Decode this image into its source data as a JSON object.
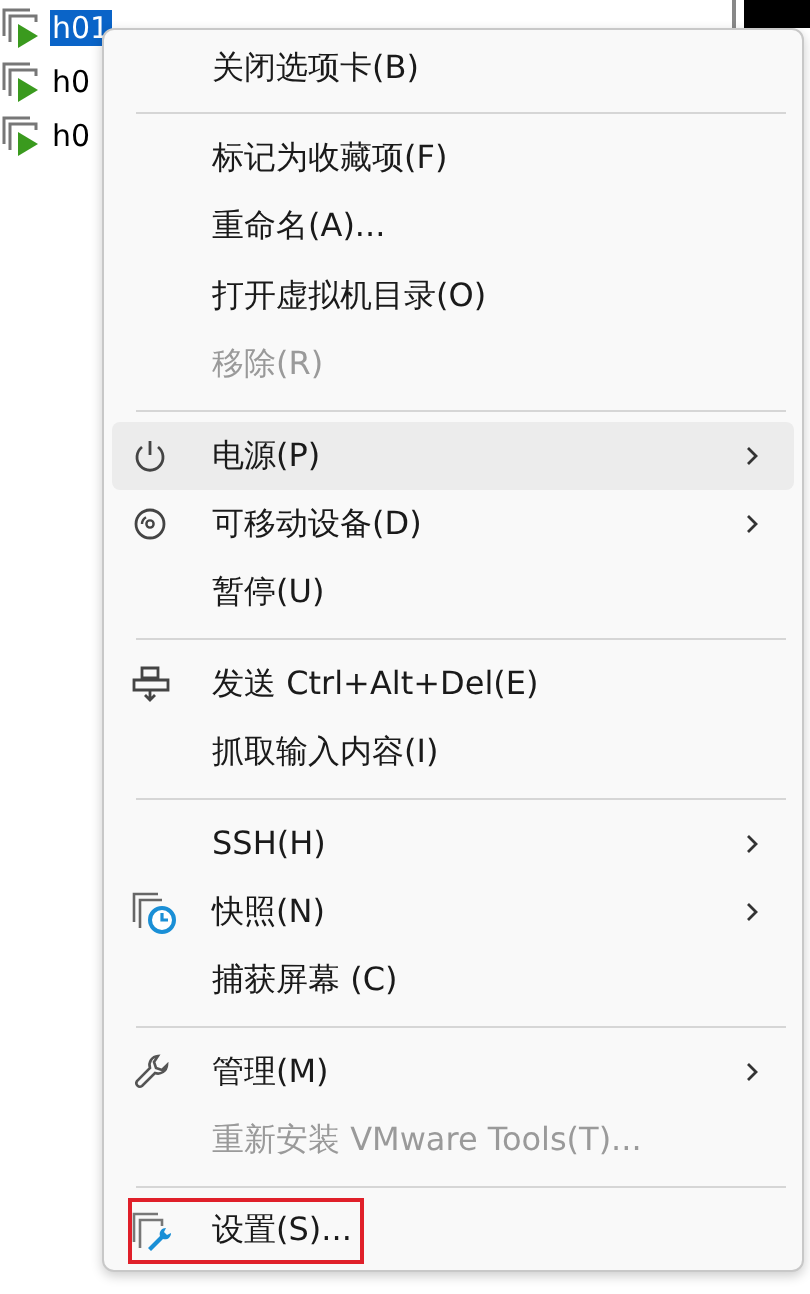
{
  "tree": [
    {
      "label": "h01",
      "selected": true
    },
    {
      "label": "h0",
      "selected": false
    },
    {
      "label": "h0",
      "selected": false
    }
  ],
  "menu": {
    "groups": [
      {
        "items": [
          {
            "label": "关闭选项卡(B)",
            "disabled": false,
            "submenu": false,
            "selected": false,
            "annotated": false
          }
        ]
      },
      {
        "items": [
          {
            "label": "标记为收藏项(F)",
            "disabled": false,
            "submenu": false,
            "selected": false,
            "annotated": false
          },
          {
            "label": "重命名(A)...",
            "disabled": false,
            "submenu": false,
            "selected": false,
            "annotated": false
          },
          {
            "label": "打开虚拟机目录(O)",
            "disabled": false,
            "submenu": false,
            "selected": false,
            "annotated": false
          },
          {
            "label": "移除(R)",
            "disabled": true,
            "submenu": false,
            "selected": false,
            "annotated": false
          }
        ]
      },
      {
        "items": [
          {
            "label": "电源(P)",
            "disabled": false,
            "submenu": true,
            "selected": true,
            "annotated": false
          },
          {
            "label": "可移动设备(D)",
            "disabled": false,
            "submenu": true,
            "selected": false,
            "annotated": false
          },
          {
            "label": "暂停(U)",
            "disabled": false,
            "submenu": false,
            "selected": false,
            "annotated": false
          }
        ]
      },
      {
        "items": [
          {
            "label": "发送 Ctrl+Alt+Del(E)",
            "disabled": false,
            "submenu": false,
            "selected": false,
            "annotated": false
          },
          {
            "label": "抓取输入内容(I)",
            "disabled": false,
            "submenu": false,
            "selected": false,
            "annotated": false
          }
        ]
      },
      {
        "items": [
          {
            "label": "SSH(H)",
            "disabled": false,
            "submenu": true,
            "selected": false,
            "annotated": false
          },
          {
            "label": "快照(N)",
            "disabled": false,
            "submenu": true,
            "selected": false,
            "annotated": false
          },
          {
            "label": "捕获屏幕 (C)",
            "disabled": false,
            "submenu": false,
            "selected": false,
            "annotated": false
          }
        ]
      },
      {
        "items": [
          {
            "label": "管理(M)",
            "disabled": false,
            "submenu": true,
            "selected": false,
            "annotated": false
          },
          {
            "label": "重新安装 VMware Tools(T)...",
            "disabled": true,
            "submenu": false,
            "selected": false,
            "annotated": false
          }
        ]
      },
      {
        "items": [
          {
            "label": "设置(S)...",
            "disabled": false,
            "submenu": false,
            "selected": false,
            "annotated": true
          }
        ]
      }
    ]
  }
}
